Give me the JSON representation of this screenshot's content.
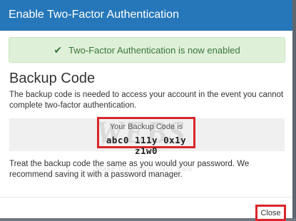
{
  "modal": {
    "title": "Enable Two-Factor Authentication",
    "alert": {
      "text": "Two-Factor Authentication is now enabled",
      "icon": "check-icon"
    },
    "heading": "Backup Code",
    "description": "The backup code is needed to access your account in the event you cannot complete two-factor authentication.",
    "code_label": "Your Backup Code is",
    "code_value": "abc0 111y 0x1y z1w0",
    "note": "Treat the backup code the same as you would your password. We recommend saving it with a password manager.",
    "close_label": "Close"
  },
  "watermark": {
    "brand": "WEBS",
    "tagline": "Make Customer, Not Sale"
  },
  "colors": {
    "header": "#2577b9",
    "alert_bg": "#dff0d8",
    "alert_text": "#3c763d",
    "highlight": "#d9262b"
  }
}
